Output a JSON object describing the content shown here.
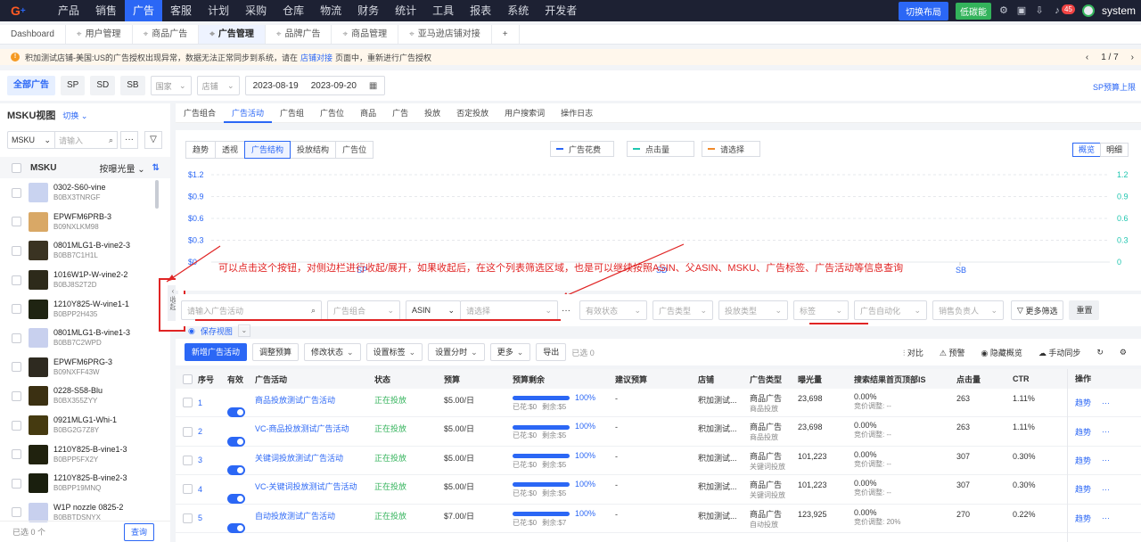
{
  "topnav": {
    "logo": "G",
    "items": [
      "产品",
      "销售",
      "广告",
      "客服",
      "计划",
      "采购",
      "仓库",
      "物流",
      "财务",
      "统计",
      "工具",
      "报表",
      "系统",
      "开发者"
    ],
    "active_index": 2,
    "switch_layout": "切换布局",
    "low_carbon": "低碳能",
    "badge_count": "45",
    "user": "system"
  },
  "tabs": [
    {
      "label": "Dashboard",
      "pin": false
    },
    {
      "label": "用户管理",
      "pin": true
    },
    {
      "label": "商品广告",
      "pin": true
    },
    {
      "label": "广告管理",
      "pin": true,
      "active": true
    },
    {
      "label": "品牌广告",
      "pin": true
    },
    {
      "label": "商品管理",
      "pin": true
    },
    {
      "label": "亚马逊店铺对接",
      "pin": true
    },
    {
      "label": "+",
      "pin": false
    }
  ],
  "notice": {
    "text_before": "积加测试店铺-美国:US的广告授权出现异常，数据无法正常同步到系统，请在",
    "link": "店铺对接",
    "text_after": "页面中，重新进行广告授权",
    "page": "1 / 7"
  },
  "filter": {
    "all_ads": "全部广告",
    "sp": "SP",
    "sd": "SD",
    "sb": "SB",
    "country": "国家",
    "shop": "店铺",
    "date_start": "2023-08-19",
    "date_sep": "–",
    "date_end": "2023-09-20",
    "budget_link": "SP预算上限"
  },
  "sidebar": {
    "title": "MSKU视图",
    "switch": "切换",
    "search_type": "MSKU",
    "search_placeholder": "请输入",
    "col_msku": "MSKU",
    "col_sort": "按曝光量",
    "items": [
      {
        "sku": "0302-S60-vine",
        "asin": "B0BX3TNRGF",
        "color": "#c9d3f0"
      },
      {
        "sku": "EPWFM6PRB-3",
        "asin": "B09NXLKM98",
        "color": "#d9a866"
      },
      {
        "sku": "0801MLG1-B-vine2-3",
        "asin": "B0BB7C1H1L",
        "color": "#3a3322"
      },
      {
        "sku": "1016W1P-W-vine2-2",
        "asin": "B0BJ8S2T2D",
        "color": "#2d2a1a"
      },
      {
        "sku": "1210Y825-W-vine1-1",
        "asin": "B0BPP2H435",
        "color": "#1f2412"
      },
      {
        "sku": "0801MLG1-B-vine1-3",
        "asin": "B0BB7C2WPD",
        "color": "#c8d0ee"
      },
      {
        "sku": "EPWFM6PRG-3",
        "asin": "B09NXFF43W",
        "color": "#2e2a20"
      },
      {
        "sku": "0228-S58-Blu",
        "asin": "B0BX355ZYY",
        "color": "#3b3012"
      },
      {
        "sku": "0921MLG1-Whi-1",
        "asin": "B0BG2G7Z8Y",
        "color": "#453a10"
      },
      {
        "sku": "1210Y825-B-vine1-3",
        "asin": "B0BPP5FX2Y",
        "color": "#20220e"
      },
      {
        "sku": "1210Y825-B-vine2-3",
        "asin": "B0BPP19MNQ",
        "color": "#1a1f0e"
      },
      {
        "sku": "W1P nozzle 0825-2",
        "asin": "B0BBTDSNYX",
        "color": "#c8d0ee"
      }
    ],
    "selected": "已选 0 个",
    "query": "查询",
    "collapse": "收起"
  },
  "main_tabs": [
    "广告组合",
    "广告活动",
    "广告组",
    "广告位",
    "商品",
    "广告",
    "投放",
    "否定投放",
    "用户搜索词",
    "操作日志"
  ],
  "main_tab_active": 1,
  "chart_seg": [
    "趋势",
    "透视",
    "广告结构",
    "投放结构",
    "广告位"
  ],
  "chart_seg_active": 2,
  "legend": [
    {
      "label": "广告花费",
      "color": "#2b67f5"
    },
    {
      "label": "点击量",
      "color": "#1fc6b0"
    },
    {
      "label": "请选择",
      "color": "#f08a2a"
    }
  ],
  "view_seg": [
    "概览",
    "明细"
  ],
  "chart_data": {
    "type": "bar",
    "categories": [
      "SP",
      "SD",
      "SB"
    ],
    "series": [
      {
        "name": "广告花费",
        "values": [
          0,
          0,
          0
        ]
      },
      {
        "name": "点击量",
        "values": [
          0,
          0,
          0
        ]
      }
    ],
    "y_left_ticks": [
      "$1.2",
      "$0.9",
      "$0.6",
      "$0.3",
      "$0"
    ],
    "y_right_ticks": [
      "1.2",
      "0.9",
      "0.6",
      "0.3",
      "0"
    ],
    "ylim": [
      0,
      1.2
    ],
    "grid": true
  },
  "annotation": "可以点击这个按钮，对侧边栏进行收起/展开，如果收起后，在这个列表筛选区域，也是可以继续按照ASIN、父ASIN、MSKU、广告标签、广告活动等信息查询",
  "filters2": {
    "campaign_placeholder": "请输入广告活动",
    "portfolio": "广告组合",
    "asin": "ASIN",
    "select": "请选择",
    "status": "有效状态",
    "ad_type": "广告类型",
    "target_type": "投放类型",
    "tag": "标签",
    "automation": "广告自动化",
    "owner": "销售负责人",
    "more": "更多筛选",
    "reset": "重置",
    "save_view": "保存视图"
  },
  "actions": {
    "new": "新增广告活动",
    "adjust_budget": "调整预算",
    "modify_status": "修改状态",
    "set_tag": "设置标签",
    "set_schedule": "设置分时",
    "more": "更多",
    "export": "导出",
    "selected": "已选 0",
    "compare": "对比",
    "alert": "预警",
    "hide_overview": "隐藏概览",
    "manual_sync": "手动同步"
  },
  "table": {
    "headers": [
      "序号",
      "有效",
      "广告活动",
      "状态",
      "预算",
      "预算剩余",
      "建议预算",
      "店铺",
      "广告类型",
      "曝光量",
      "搜索结果首页顶部IS",
      "点击量",
      "CTR",
      "操作"
    ],
    "rows": [
      {
        "no": "1",
        "name": "商品投放测试广告活动",
        "status": "正在投放",
        "budget": "$5.00/日",
        "pct": "100%",
        "spent": "已花:$0",
        "left": "剩余:$5",
        "suggest": "-",
        "shop": "积加测试...",
        "type": "商品广告",
        "subtype": "商品投放",
        "imp": "23,698",
        "is": "0.00%",
        "bid": "竞价调整: --",
        "clicks": "263",
        "ctr": "1.11%",
        "op": "趋势"
      },
      {
        "no": "2",
        "name": "VC-商品投放测试广告活动",
        "status": "正在投放",
        "budget": "$5.00/日",
        "pct": "100%",
        "spent": "已花:$0",
        "left": "剩余:$5",
        "suggest": "-",
        "shop": "积加测试...",
        "type": "商品广告",
        "subtype": "商品投放",
        "imp": "23,698",
        "is": "0.00%",
        "bid": "竞价调整: --",
        "clicks": "263",
        "ctr": "1.11%",
        "op": "趋势"
      },
      {
        "no": "3",
        "name": "关键词投放测试广告活动",
        "status": "正在投放",
        "budget": "$5.00/日",
        "pct": "100%",
        "spent": "已花:$0",
        "left": "剩余:$5",
        "suggest": "-",
        "shop": "积加测试...",
        "type": "商品广告",
        "subtype": "关键词投放",
        "imp": "101,223",
        "is": "0.00%",
        "bid": "竞价调整: --",
        "clicks": "307",
        "ctr": "0.30%",
        "op": "趋势"
      },
      {
        "no": "4",
        "name": "VC-关键词投放测试广告活动",
        "status": "正在投放",
        "budget": "$5.00/日",
        "pct": "100%",
        "spent": "已花:$0",
        "left": "剩余:$5",
        "suggest": "-",
        "shop": "积加测试...",
        "type": "商品广告",
        "subtype": "关键词投放",
        "imp": "101,223",
        "is": "0.00%",
        "bid": "竞价调整: --",
        "clicks": "307",
        "ctr": "0.30%",
        "op": "趋势"
      },
      {
        "no": "5",
        "name": "自动投放测试广告活动",
        "status": "正在投放",
        "budget": "$7.00/日",
        "pct": "100%",
        "spent": "已花:$0",
        "left": "剩余:$7",
        "suggest": "-",
        "shop": "积加测试...",
        "type": "商品广告",
        "subtype": "自动投放",
        "imp": "123,925",
        "is": "0.00%",
        "bid": "竞价调整: 20%",
        "clicks": "270",
        "ctr": "0.22%",
        "op": "趋势"
      }
    ]
  }
}
